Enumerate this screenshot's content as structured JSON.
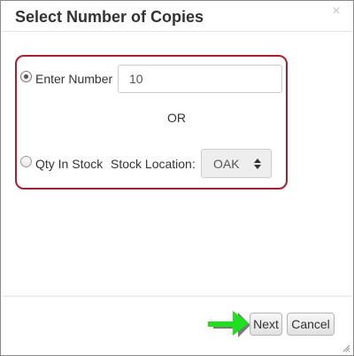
{
  "dialog": {
    "title": "Select Number of Copies",
    "close_glyph": "×"
  },
  "options": {
    "enter_number": {
      "label": "Enter Number",
      "selected": true,
      "value": "10"
    },
    "separator": "OR",
    "qty_in_stock": {
      "label": "Qty In Stock",
      "selected": false
    },
    "stock_location": {
      "label": "Stock Location:",
      "selected_value": "OAK"
    }
  },
  "footer": {
    "next_label": "Next",
    "cancel_label": "Cancel"
  },
  "colors": {
    "highlight_border": "#a52030",
    "annotation_arrow": "#1fe01f"
  },
  "icons": {
    "close": "close-icon",
    "select_arrows": "sort-arrows-icon",
    "annotation": "pointer-arrow-icon",
    "resize": "resize-grip-icon"
  }
}
